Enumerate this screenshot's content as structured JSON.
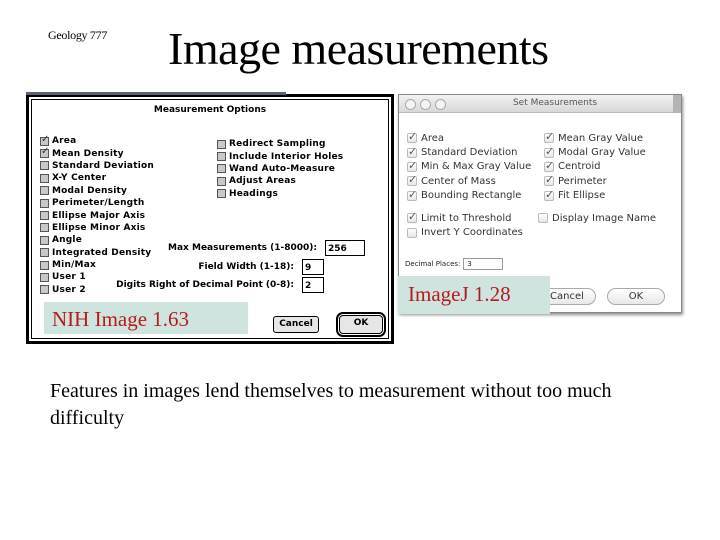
{
  "slide": {
    "label": "Geology 777",
    "title": "Image measurements",
    "body": "Features in images lend themselves to measurement without too much difficulty"
  },
  "nih_dialog": {
    "title": "Measurement Options",
    "caption": "NIH Image 1.63",
    "left_options": [
      {
        "label": "Area",
        "checked": true
      },
      {
        "label": "Mean Density",
        "checked": true
      },
      {
        "label": "Standard Deviation",
        "checked": false
      },
      {
        "label": "X-Y Center",
        "checked": false
      },
      {
        "label": "Modal Density",
        "checked": false
      },
      {
        "label": "Perimeter/Length",
        "checked": false
      },
      {
        "label": "Ellipse Major Axis",
        "checked": false
      },
      {
        "label": "Ellipse Minor Axis",
        "checked": false
      },
      {
        "label": "Angle",
        "checked": false
      },
      {
        "label": "Integrated Density",
        "checked": false
      },
      {
        "label": "Min/Max",
        "checked": false
      },
      {
        "label": "User 1",
        "checked": false
      },
      {
        "label": "User 2",
        "checked": false
      }
    ],
    "right_options": [
      {
        "label": "Redirect Sampling",
        "checked": false
      },
      {
        "label": "Include Interior Holes",
        "checked": false
      },
      {
        "label": "Wand Auto-Measure",
        "checked": false
      },
      {
        "label": "Adjust Areas",
        "checked": false
      },
      {
        "label": "Headings",
        "checked": false
      }
    ],
    "fields": [
      {
        "label": "Max Measurements (1-8000):",
        "value": "256"
      },
      {
        "label": "Field Width (1-18):",
        "value": "9"
      },
      {
        "label": "Digits Right of Decimal Point (0-8):",
        "value": "2"
      }
    ],
    "cancel_label": "Cancel",
    "ok_label": "OK"
  },
  "imagej_dialog": {
    "title": "Set Measurements",
    "caption": "ImageJ 1.28",
    "left_options": [
      {
        "label": "Area",
        "checked": true
      },
      {
        "label": "Standard Deviation",
        "checked": true
      },
      {
        "label": "Min & Max Gray Value",
        "checked": true
      },
      {
        "label": "Center of Mass",
        "checked": true
      },
      {
        "label": "Bounding Rectangle",
        "checked": true
      }
    ],
    "right_options": [
      {
        "label": "Mean Gray Value",
        "checked": true
      },
      {
        "label": "Modal Gray Value",
        "checked": true
      },
      {
        "label": "Centroid",
        "checked": true
      },
      {
        "label": "Perimeter",
        "checked": true
      },
      {
        "label": "Fit Ellipse",
        "checked": true
      }
    ],
    "extra_left": [
      {
        "label": "Limit to Threshold",
        "checked": true
      },
      {
        "label": "Invert Y Coordinates",
        "checked": false
      }
    ],
    "extra_right": [
      {
        "label": "Display Image Name",
        "checked": false
      }
    ],
    "decimal_label": "Decimal Places:",
    "decimal_value": "3",
    "cancel_label": "Cancel",
    "ok_label": "OK"
  }
}
